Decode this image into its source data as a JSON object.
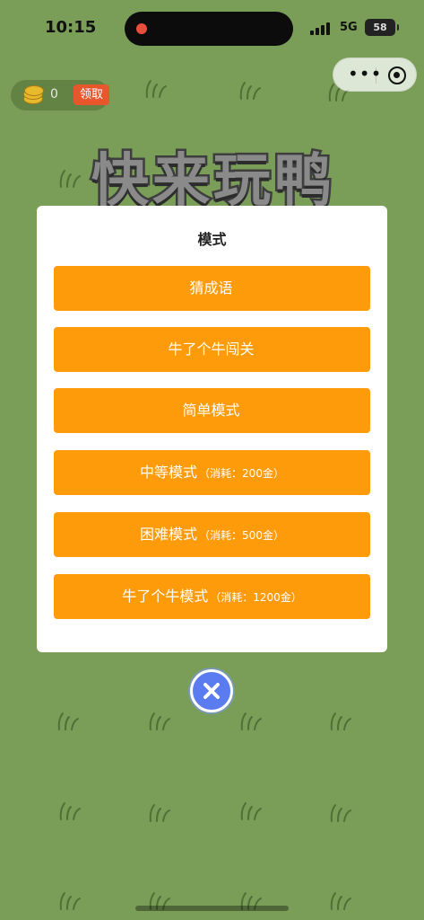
{
  "status_bar": {
    "time": "10:15",
    "network": "5G",
    "battery": "58"
  },
  "coins": {
    "count": "0",
    "claim_label": "领取"
  },
  "game_title": "快来玩鸭",
  "modal": {
    "title": "模式",
    "buttons": [
      {
        "label": "猜成语",
        "cost": ""
      },
      {
        "label": "牛了个牛闯关",
        "cost": ""
      },
      {
        "label": "简单模式",
        "cost": ""
      },
      {
        "label": "中等模式",
        "cost": "（消耗：200金）"
      },
      {
        "label": "困难模式",
        "cost": "（消耗：500金）"
      },
      {
        "label": "牛了个牛模式",
        "cost": "（消耗：1200金）"
      }
    ]
  },
  "colors": {
    "background": "#7a9e57",
    "button": "#fe9b0b",
    "claim": "#e8562c",
    "close": "#5b7cf0"
  },
  "icons": {
    "capsule_more": "more-icon",
    "capsule_close": "target-icon",
    "modal_close": "close-icon",
    "coin": "coin-stack-icon"
  }
}
